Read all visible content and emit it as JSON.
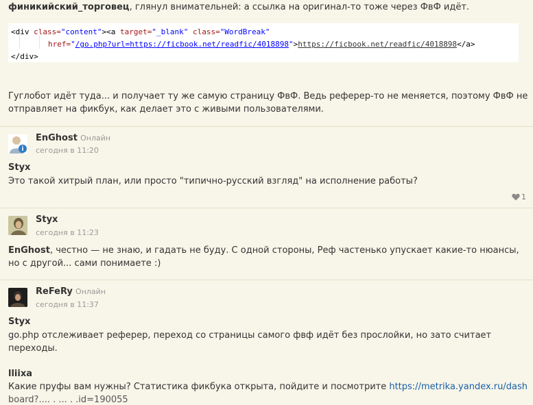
{
  "top": {
    "author": "финикийский_торговец",
    "text": ", глянул внимательней: а ссылка на оригинал-то тоже через ФвФ идёт."
  },
  "code": {
    "l1_tag_open": "<div ",
    "l1_class_attr": "class=",
    "l1_class_val": "\"content\"",
    "l1_a_open": "><a ",
    "l1_target_attr": "target=",
    "l1_target_val": "\"_blank\"",
    "l1_class2_attr": " class=",
    "l1_class2_val": "\"WordBreak\"",
    "l2_href_attr": "href=",
    "l2_href_q1": "\"",
    "l2_href_val": "/go.php?url=https://ficbook.net/readfic/4018898",
    "l2_href_q2": "\"",
    "l2_gt": ">",
    "l2_text": "https://ficbook.net/readfic/4018898",
    "l2_close": "</a>",
    "l3_close": "</div>"
  },
  "para": {
    "line1": "Гуглобот идёт туда... и получает ту же самую страницу ФвФ. Ведь реферер-то не меняется, поэтому ФвФ не",
    "line2": "отправляет на фикбук, как делает это с живыми пользователями."
  },
  "comments": [
    {
      "user": "EnGhost",
      "status": "Онлайн",
      "time": "сегодня в 11:20",
      "reply_to": "Styx",
      "text": "Это такой хитрый план, или просто \"типично-русский взгляд\" на исполнение работы?",
      "likes": "1"
    },
    {
      "user": "Styx",
      "time": "сегодня в 11:23",
      "reply_to": "EnGhost",
      "line1": ", честно — не знаю, и гадать не буду. С одной стороны, Реф частенько упускает какие-то нюансы,",
      "line2": "но с другой... сами понимаете :)"
    },
    {
      "user": "ReFeRy",
      "status": "Онлайн",
      "time": "сегодня в 11:37",
      "reply1": "Styx",
      "text1_line1": "go.php отслеживает реферер, переход со страницы самого фвф идёт без прослойки, но зато считает",
      "text1_line2": "переходы.",
      "reply2": "lliixa",
      "text2_prefix": "Какие пруфы вам нужны? Статистика фикбука открыта, пойдите и посмотрите ",
      "text2_link": "https://metrika.yandex.ru/dash",
      "text2_cut": "board?....  .  ...  .  .id=190055"
    }
  ],
  "icons": {
    "heart": "heart-icon",
    "info_badge": "info-icon"
  },
  "colors": {
    "background": "#f8f6e9",
    "link": "#1a5fa8"
  }
}
